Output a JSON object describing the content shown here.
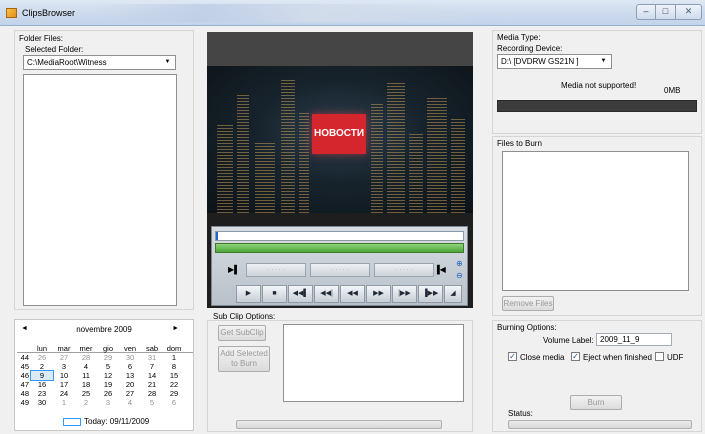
{
  "window": {
    "title": "ClipsBrowser",
    "min": "–",
    "max": "□",
    "close": "✕"
  },
  "left": {
    "group_label": "Folder Files:",
    "selected_folder_label": "Selected Folder:",
    "folder_value": "C:\\MediaRoot\\Witness"
  },
  "calendar": {
    "month": "novembre 2009",
    "prev": "◄",
    "next": "►",
    "days": [
      "lun",
      "mar",
      "mer",
      "gio",
      "ven",
      "sab",
      "dom"
    ],
    "weeks": [
      {
        "wk": "44",
        "d": [
          "26",
          "27",
          "28",
          "29",
          "30",
          "31",
          "1"
        ]
      },
      {
        "wk": "45",
        "d": [
          "2",
          "3",
          "4",
          "5",
          "6",
          "7",
          "8"
        ]
      },
      {
        "wk": "46",
        "d": [
          "9",
          "10",
          "11",
          "12",
          "13",
          "14",
          "15"
        ]
      },
      {
        "wk": "47",
        "d": [
          "16",
          "17",
          "18",
          "19",
          "20",
          "21",
          "22"
        ]
      },
      {
        "wk": "48",
        "d": [
          "23",
          "24",
          "25",
          "26",
          "27",
          "28",
          "29"
        ]
      },
      {
        "wk": "49",
        "d": [
          "30",
          "1",
          "2",
          "3",
          "4",
          "5",
          "6"
        ]
      }
    ],
    "today": "Today: 09/11/2009"
  },
  "video": {
    "banner": "НОВОСТИ"
  },
  "subclip": {
    "label": "Sub Clip Options:",
    "get_btn": "Get SubClip",
    "add_btn_line1": "Add Selected",
    "add_btn_line2": "to Burn"
  },
  "right": {
    "media_type_label": "Media Type:",
    "recording_device_label": "Recording Device:",
    "device_value": "D:\\ [DVDRW  GS21N    ]",
    "media_status": "Media not supported!",
    "media_size": "0MB",
    "files_to_burn_label": "Files to Burn",
    "remove_btn": "Remove Files",
    "burning_options_label": "Burning Options:",
    "volume_label_label": "Volume Label:",
    "volume_label_value": "2009_11_9",
    "close_media_label": "Close media",
    "eject_label": "Eject when finished",
    "udf_label": "UDF",
    "burn_btn": "Burn",
    "status_label": "Status:"
  },
  "colors": {
    "accent": "#3399ff",
    "banner_red": "#d6262d",
    "green_track": "#4ea436"
  }
}
